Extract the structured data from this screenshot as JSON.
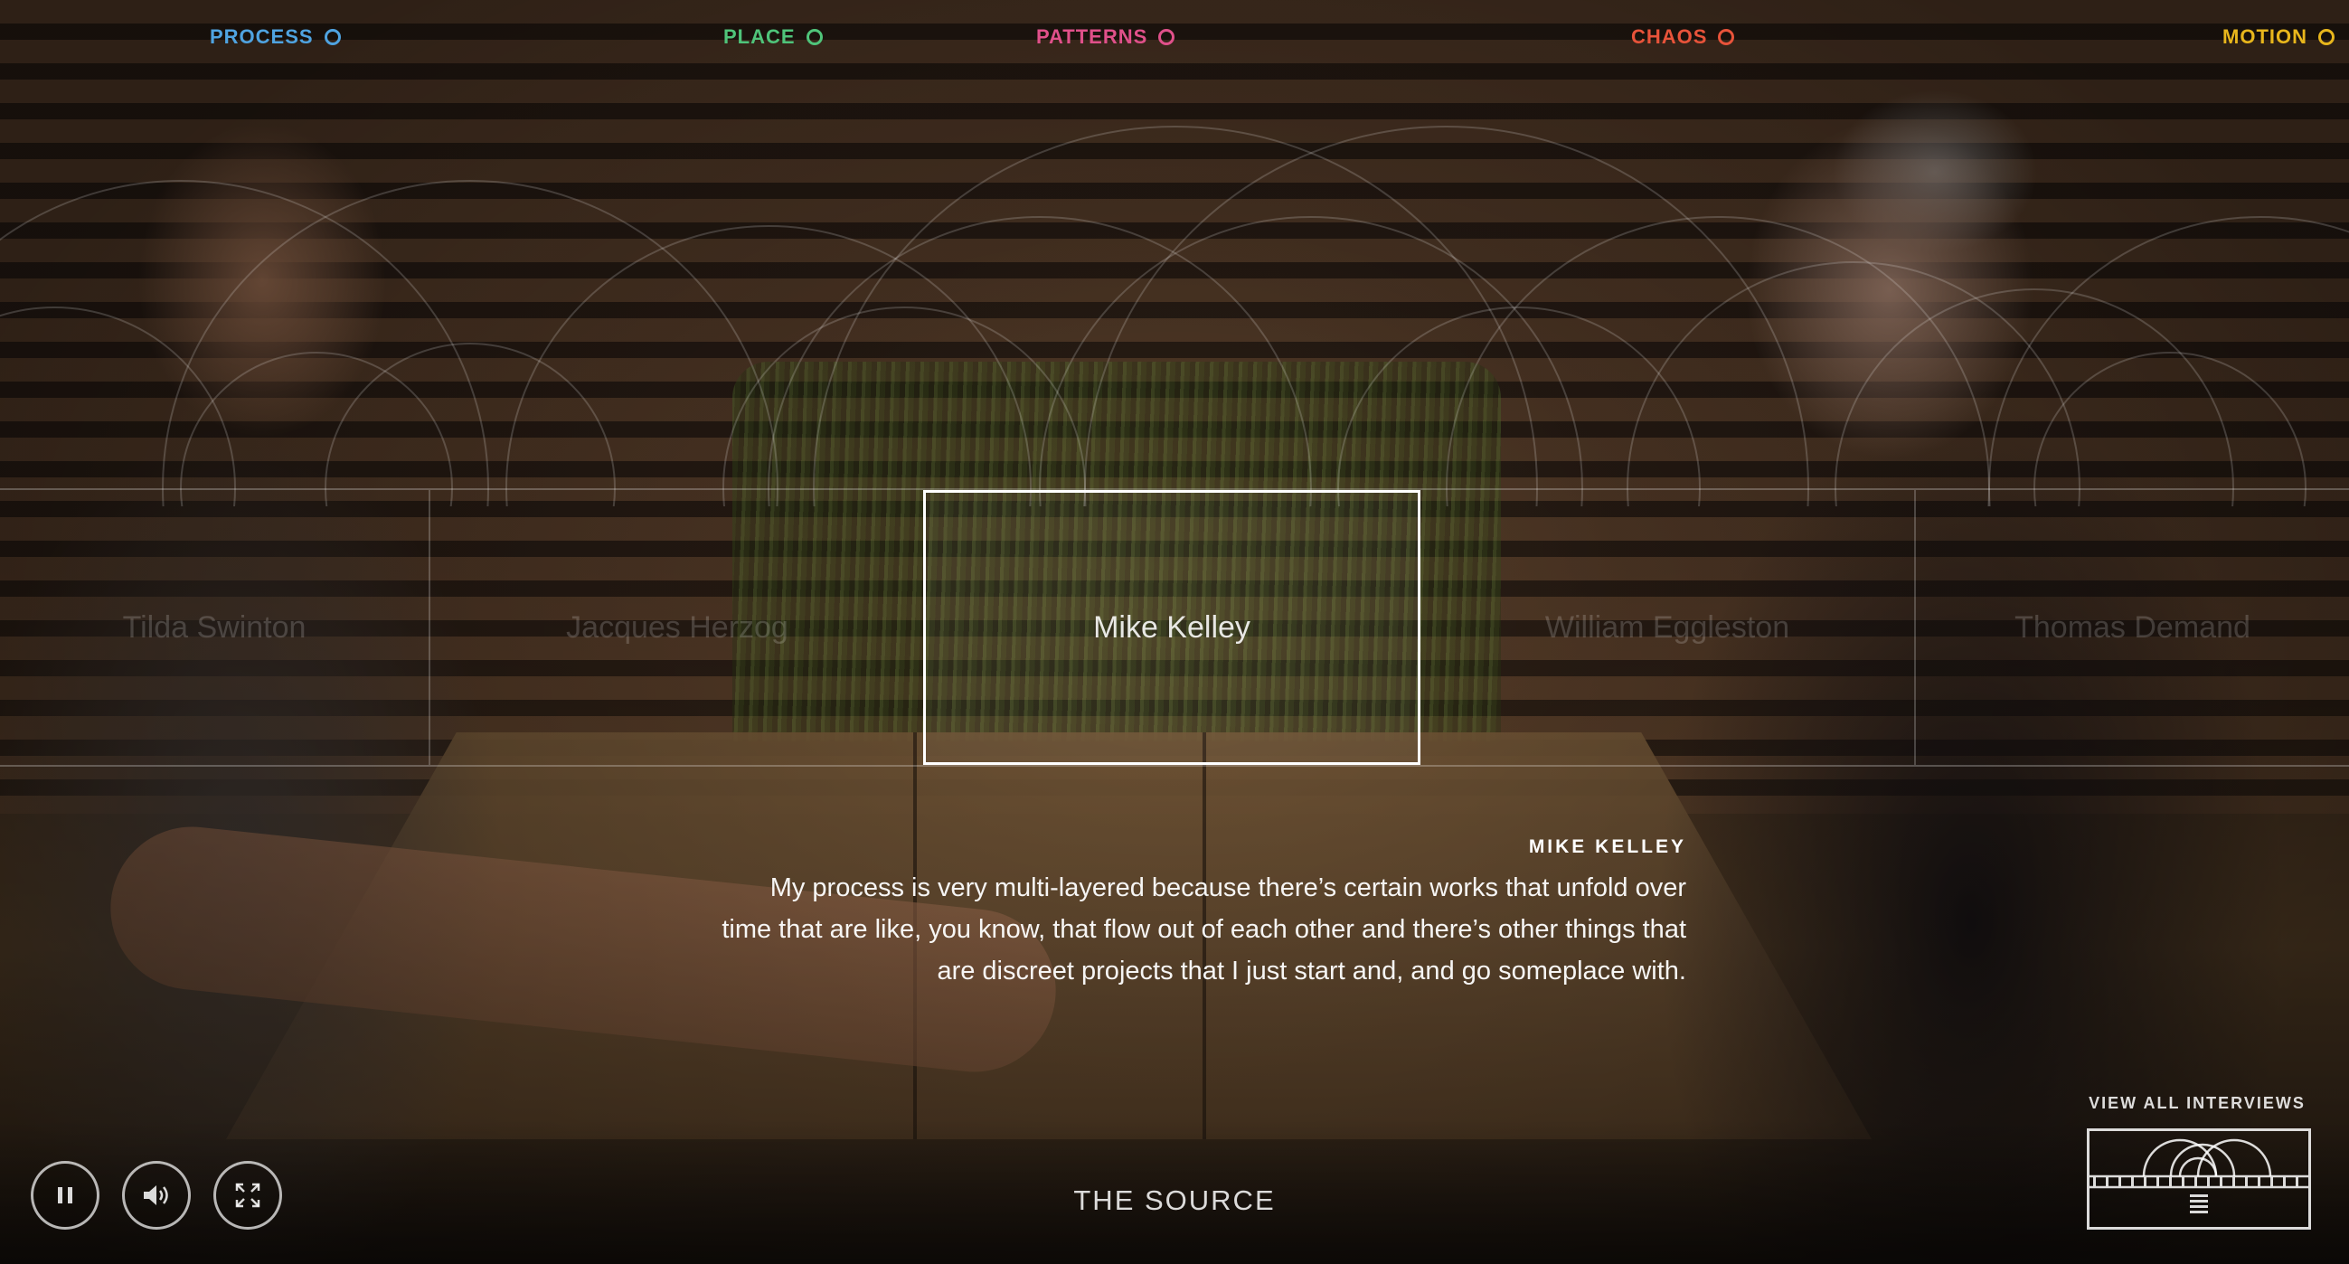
{
  "nav": {
    "categories": [
      {
        "label": "PROCESS",
        "color": "#4fa3e0"
      },
      {
        "label": "PLACE",
        "color": "#4fc47a"
      },
      {
        "label": "PATTERNS",
        "color": "#e0508a"
      },
      {
        "label": "CHAOS",
        "color": "#e8533a"
      },
      {
        "label": "MOTION",
        "color": "#e8b61c"
      }
    ]
  },
  "interviews": {
    "items": [
      {
        "name": "Tilda Swinton"
      },
      {
        "name": "Jacques Herzog"
      },
      {
        "name": "Mike Kelley",
        "active": true
      },
      {
        "name": "William Eggleston"
      },
      {
        "name": "Thomas Demand"
      }
    ]
  },
  "quote": {
    "speaker": "MIKE KELLEY",
    "lines": [
      "My process is very multi-layered because there’s certain works that unfold over",
      "time that are like, you know, that flow out of each other and there’s other things that",
      "are discreet projects that I just start and, and go someplace with."
    ]
  },
  "controls": {
    "pause_icon": "pause-icon",
    "volume_icon": "volume-icon",
    "fullscreen_icon": "fullscreen-icon"
  },
  "footer": {
    "title": "THE SOURCE",
    "view_all_label": "VIEW ALL INTERVIEWS"
  }
}
